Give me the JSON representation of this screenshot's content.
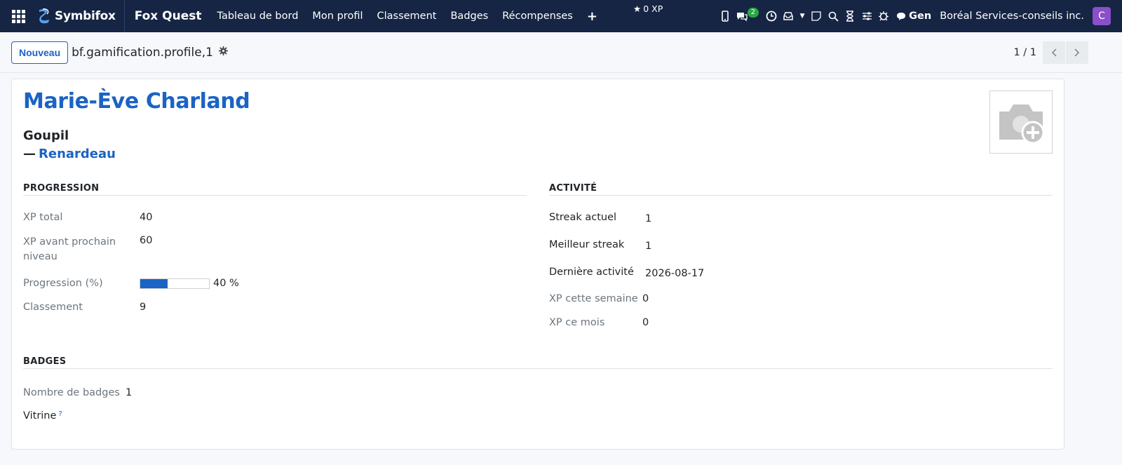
{
  "navbar": {
    "brand": "Symbifox",
    "app_title": "Fox Quest",
    "menu": [
      "Tableau de bord",
      "Mon profil",
      "Classement",
      "Badges",
      "Récompenses"
    ],
    "xp_label": "0 XP",
    "chat_badge": "2",
    "gen_label": "Gen",
    "company": "Boréal Services-conseils inc.",
    "avatar_letter": "C",
    "avatar_color": "#8a4fc9"
  },
  "control": {
    "new_button": "Nouveau",
    "record_name": "bf.gamification.profile,1",
    "pager": "1 / 1"
  },
  "record": {
    "name": "Marie-Ève Charland",
    "subtitle": "Goupil",
    "parent_dash": "—",
    "parent": "Renardeau"
  },
  "progression": {
    "title": "PROGRESSION",
    "xp_total_label": "XP total",
    "xp_total": "40",
    "xp_next_label": "XP avant prochain niveau",
    "xp_next": "60",
    "progress_label": "Progression (%)",
    "progress_value": 40,
    "progress_text": "40 %",
    "rank_label": "Classement",
    "rank": "9"
  },
  "activity": {
    "title": "ACTIVITÉ",
    "streak_label": "Streak actuel",
    "streak": "1",
    "best_streak_label": "Meilleur streak",
    "best_streak": "1",
    "last_activity_label": "Dernière activité",
    "last_activity": "2026-08-17",
    "xp_week_label": "XP cette semaine",
    "xp_week": "0",
    "xp_month_label": "XP ce mois",
    "xp_month": "0"
  },
  "badges": {
    "title": "BADGES",
    "count_label": "Nombre de badges",
    "count": "1",
    "showcase_label": "Vitrine",
    "help_mark": "?"
  },
  "colors": {
    "navbar_bg": "#162544",
    "accent": "#1b63c4",
    "badge_green": "#28a745"
  }
}
